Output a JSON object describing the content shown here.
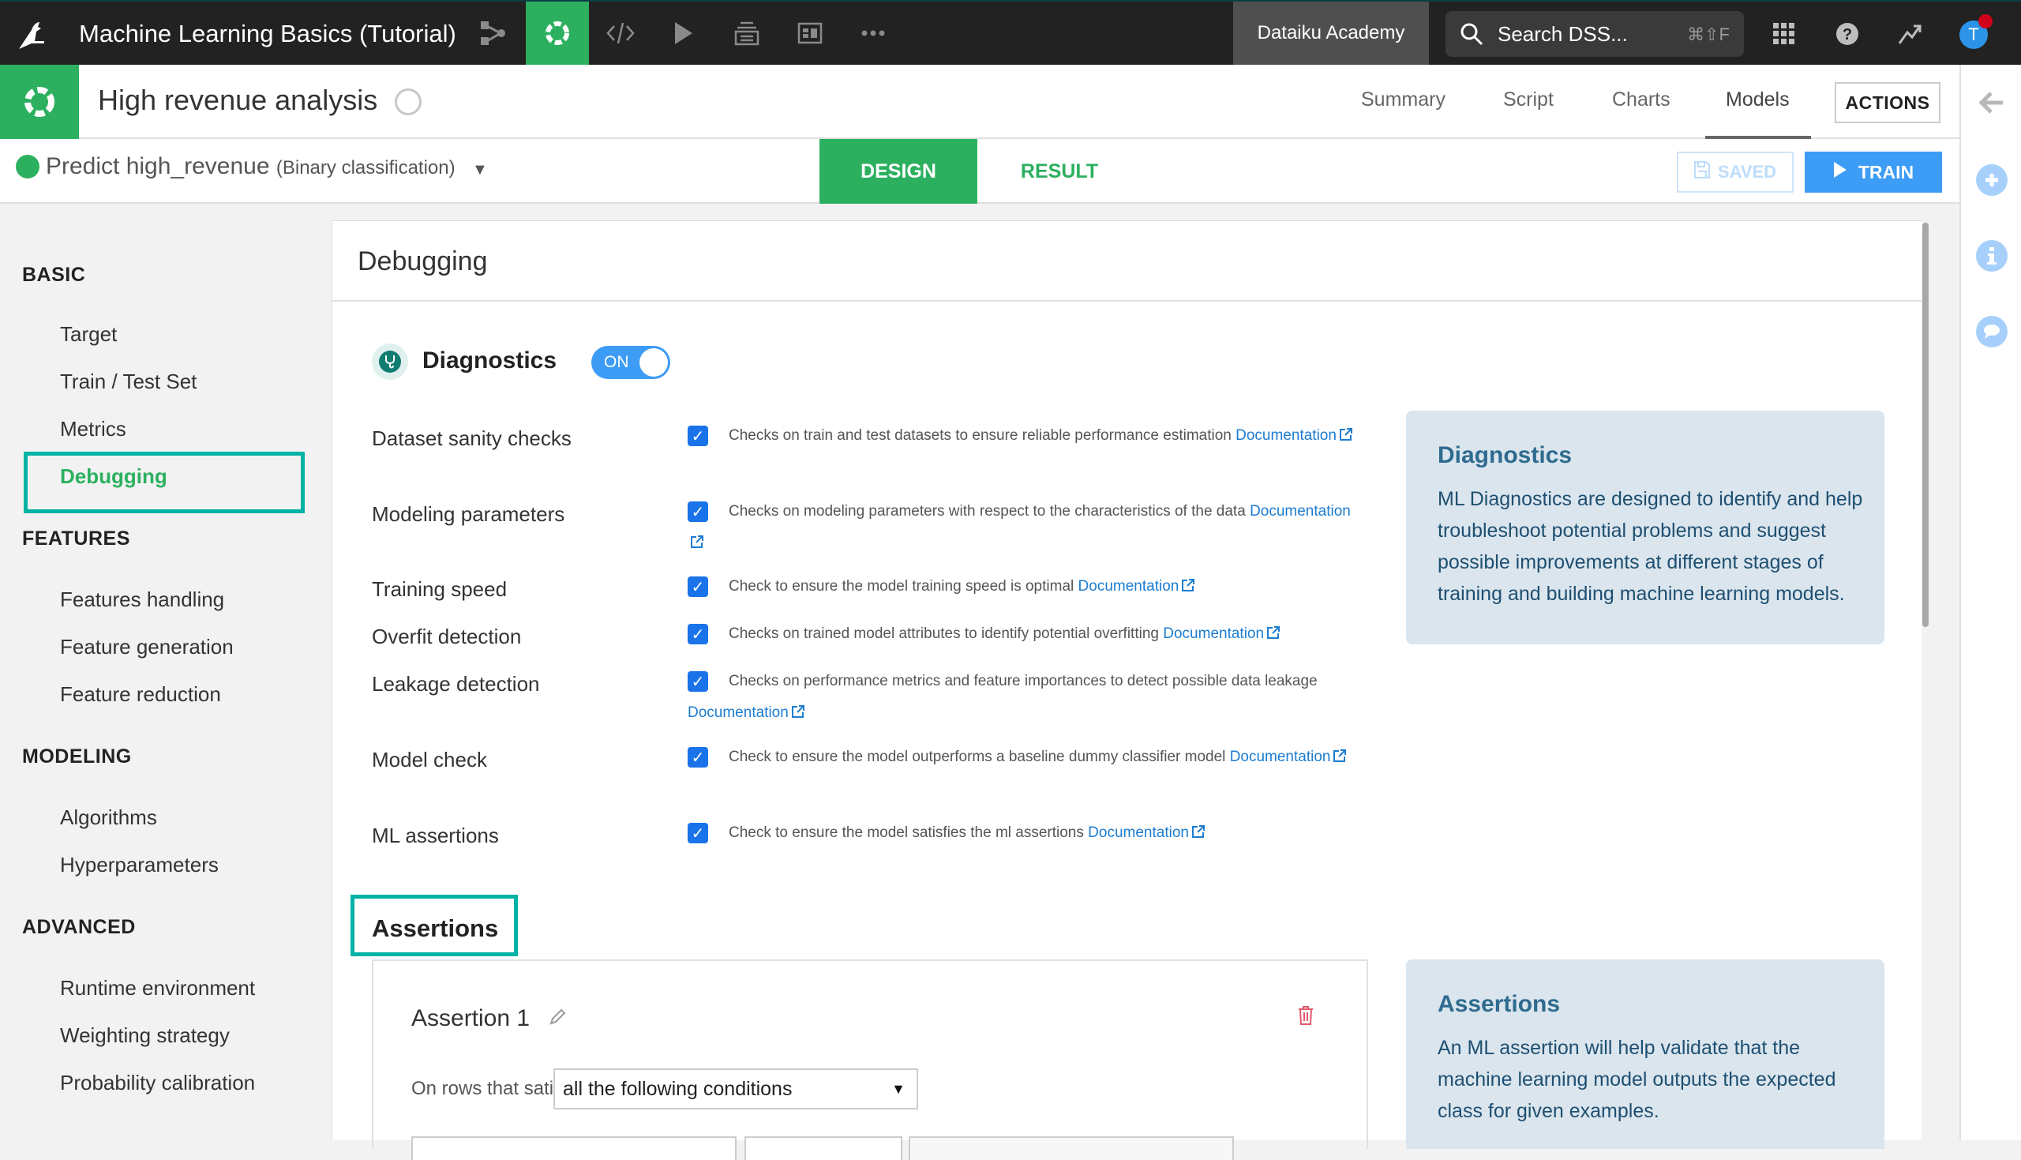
{
  "topbar": {
    "project_title": "Machine Learning Basics (Tutorial)",
    "nav_icons": [
      "flow-icon",
      "lab-icon",
      "code-icon",
      "run-icon",
      "deploy-icon",
      "dashboard-icon",
      "more-icon"
    ],
    "active_icon": "lab-icon",
    "instance_label": "Dataiku Academy",
    "search_placeholder": "Search DSS...",
    "search_shortcut": "⌘⇧F",
    "avatar_initial": "T"
  },
  "header": {
    "analysis_title": "High revenue analysis",
    "tabs": [
      {
        "label": "Summary",
        "active": false
      },
      {
        "label": "Script",
        "active": false
      },
      {
        "label": "Charts",
        "active": false
      },
      {
        "label": "Models",
        "active": true
      }
    ],
    "actions_label": "ACTIONS"
  },
  "subheader": {
    "model_title": "Predict high_revenue",
    "model_type": "(Binary classification)",
    "tabs": [
      {
        "label": "DESIGN",
        "active": true
      },
      {
        "label": "RESULT",
        "active": false
      }
    ],
    "saved_label": "SAVED",
    "train_label": "TRAIN"
  },
  "sidebar": {
    "sections": [
      {
        "title": "BASIC",
        "items": [
          "Target",
          "Train / Test Set",
          "Metrics",
          "Debugging"
        ]
      },
      {
        "title": "FEATURES",
        "items": [
          "Features handling",
          "Feature generation",
          "Feature reduction"
        ]
      },
      {
        "title": "MODELING",
        "items": [
          "Algorithms",
          "Hyperparameters"
        ]
      },
      {
        "title": "ADVANCED",
        "items": [
          "Runtime environment",
          "Weighting strategy",
          "Probability calibration"
        ]
      }
    ],
    "active_item": "Debugging"
  },
  "main": {
    "title": "Debugging",
    "diagnostics": {
      "title": "Diagnostics",
      "toggle_label": "ON",
      "toggle_on": true,
      "doc_label": "Documentation",
      "checks": [
        {
          "label": "Dataset sanity checks",
          "checked": true,
          "description": "Checks on train and test datasets to ensure reliable performance estimation"
        },
        {
          "label": "Modeling parameters",
          "checked": true,
          "description": "Checks on modeling parameters with respect to the characteristics of the data"
        },
        {
          "label": "Training speed",
          "checked": true,
          "description": "Check to ensure the model training speed is optimal"
        },
        {
          "label": "Overfit detection",
          "checked": true,
          "description": "Checks on trained model attributes to identify potential overfitting"
        },
        {
          "label": "Leakage detection",
          "checked": true,
          "description": "Checks on performance metrics and feature importances to detect possible data leakage"
        },
        {
          "label": "Model check",
          "checked": true,
          "description": "Check to ensure the model outperforms a baseline dummy classifier model"
        },
        {
          "label": "ML assertions",
          "checked": true,
          "description": "Check to ensure the model satisfies the ml assertions"
        }
      ]
    },
    "diagnostics_info": {
      "title": "Diagnostics",
      "body": "ML Diagnostics are designed to identify and help troubleshoot potential problems and suggest possible improvements at different stages of training and building machine learning models."
    },
    "assertions": {
      "title": "Assertions",
      "items": [
        {
          "name": "Assertion 1",
          "rows_label": "On rows that satisfy",
          "rows_value": "all the following conditions"
        }
      ]
    },
    "assertions_info": {
      "title": "Assertions",
      "body": "An ML assertion will help validate that the machine learning model outputs the expected class for given examples."
    }
  },
  "colors": {
    "brand_green": "#2cb05f",
    "highlight_teal": "#00b3a4",
    "primary_blue": "#3d9cf5",
    "link_blue": "#1c7cd0",
    "info_bg": "#dae5ee",
    "topbar_bg": "#222222"
  }
}
